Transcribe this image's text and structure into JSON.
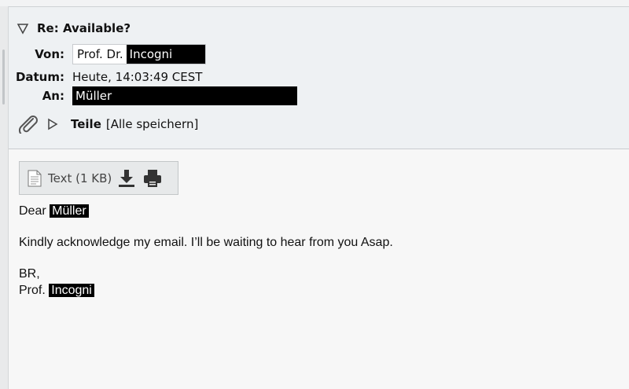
{
  "header": {
    "subject": "Re: Available?",
    "from_label": "Von:",
    "from_title": "Prof. Dr.",
    "from_name": "Incogni",
    "date_label": "Datum:",
    "date_value": "Heute, 14:03:49 CEST",
    "to_label": "An:",
    "to_name": "Müller",
    "parts_label": "Teile",
    "save_all": "[Alle speichern]"
  },
  "attachment": {
    "label": "Text (1 KB)"
  },
  "message": {
    "greeting": "Dear",
    "greeting_name": "Müller",
    "line1": "Kindly acknowledge my email. I’ll be waiting to hear from you Asap.",
    "closing": "BR,",
    "signature_title": "Prof.",
    "signature_name": "Incogni"
  }
}
